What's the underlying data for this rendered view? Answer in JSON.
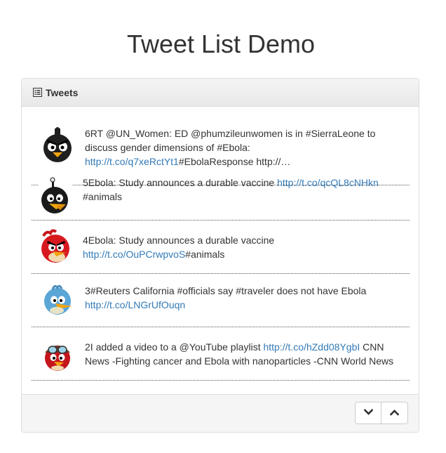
{
  "page": {
    "title": "Tweet List Demo"
  },
  "panel": {
    "heading": "Tweets",
    "heading_icon": "list-icon"
  },
  "tweets": [
    {
      "number": "6",
      "avatar": "black-bird-avatar",
      "segments": [
        {
          "type": "text",
          "value": "RT @UN_Women: ED @phumzileunwomen is in #SierraLeone to discuss gender dimensions of #Ebola: "
        },
        {
          "type": "link",
          "value": "http://t.co/q7xeRctYt1"
        },
        {
          "type": "text",
          "value": "#EbolaResponse http://…"
        }
      ]
    },
    {
      "number": "5",
      "avatar": "bomb-bird-avatar",
      "segments": [
        {
          "type": "text",
          "value": "Ebola: Study announces a durable vaccine "
        },
        {
          "type": "link",
          "value": "http://t.co/qcQL8cNHkn"
        },
        {
          "type": "text",
          "value": " #animals"
        }
      ]
    },
    {
      "number": "4",
      "avatar": "red-bird-avatar",
      "segments": [
        {
          "type": "text",
          "value": "Ebola: Study announces a durable vaccine "
        },
        {
          "type": "link",
          "value": "http://t.co/OuPCrwpvoS"
        },
        {
          "type": "text",
          "value": "#animals"
        }
      ]
    },
    {
      "number": "3",
      "avatar": "blue-bird-avatar",
      "segments": [
        {
          "type": "text",
          "value": "#Reuters California #officials say #traveler does not have Ebola "
        },
        {
          "type": "link",
          "value": "http://t.co/LNGrUfOuqn"
        }
      ]
    },
    {
      "number": "2",
      "avatar": "pilot-bird-avatar",
      "segments": [
        {
          "type": "text",
          "value": "I added a video to a @YouTube playlist "
        },
        {
          "type": "link",
          "value": "http://t.co/hZdd08YgbI"
        },
        {
          "type": "text",
          "value": " CNN News -Fighting cancer and Ebola with nanoparticles -CNN World News"
        }
      ]
    }
  ],
  "footer": {
    "next_icon": "chevron-down-icon",
    "prev_icon": "chevron-up-icon"
  },
  "colors": {
    "link": "#337ab7",
    "text": "#333333",
    "border": "#dddddd"
  }
}
